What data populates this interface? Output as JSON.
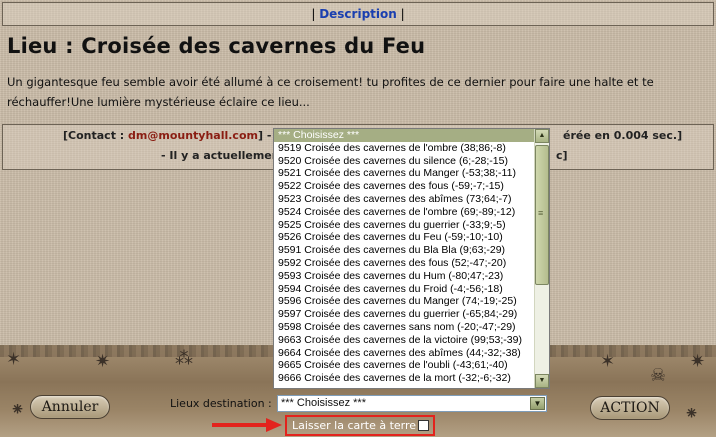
{
  "nav": {
    "link_label": "Description",
    "separator": "|"
  },
  "page_title": "Lieu : Croisée des cavernes du Feu",
  "description": "Un gigantesque feu semble avoir été allumé à ce croisement! tu profites de ce dernier pour faire une halte et te réchauffer!Une lumière mystérieuse éclaire ce lieu...",
  "info": {
    "contact_prefix": "[Contact : ",
    "email": "dm@mountyhall.com",
    "contact_suffix": "] - [He",
    "line1_right": "érée en 0.004 sec.]",
    "line2": "- Il y a actuellement",
    "line2_right": "c]"
  },
  "buttons": {
    "annuler": "Annuler",
    "action": "ACTION"
  },
  "lieux": {
    "label": "Lieux destination :",
    "selected": "*** Choisissez ***",
    "options": [
      "*** Choisissez ***",
      "9519 Croisée des cavernes de l'ombre (38;86;-8)",
      "9520 Croisée des cavernes du silence (6;-28;-15)",
      "9521 Croisée des cavernes du Manger (-53;38;-11)",
      "9522 Croisée des cavernes des fous (-59;-7;-15)",
      "9523 Croisée des cavernes des abîmes (73;64;-7)",
      "9524 Croisée des cavernes de l'ombre (69;-89;-12)",
      "9525 Croisée des cavernes du guerrier (-33;9;-5)",
      "9526 Croisée des cavernes du Feu (-59;-10;-10)",
      "9591 Croisée des cavernes du Bla Bla (9;63;-29)",
      "9592 Croisée des cavernes des fous (52;-47;-20)",
      "9593 Croisée des cavernes du Hum (-80;47;-23)",
      "9594 Croisée des cavernes du Froid (-4;-56;-18)",
      "9596 Croisée des cavernes du Manger (74;-19;-25)",
      "9597 Croisée des cavernes du guerrier (-65;84;-29)",
      "9598 Croisée des cavernes sans nom (-20;-47;-29)",
      "9663 Croisée des cavernes de la victoire (99;53;-39)",
      "9664 Croisée des cavernes des abîmes (44;-32;-38)",
      "9665 Croisée des cavernes de l'oubli (-43;61;-40)",
      "9666 Croisée des cavernes de la mort (-32;-6;-32)"
    ]
  },
  "checkbox_label": "Laisser la carte à terre",
  "colors": {
    "highlight": "#e3231d",
    "link": "#1a3fb0",
    "email": "#8a1d12"
  }
}
